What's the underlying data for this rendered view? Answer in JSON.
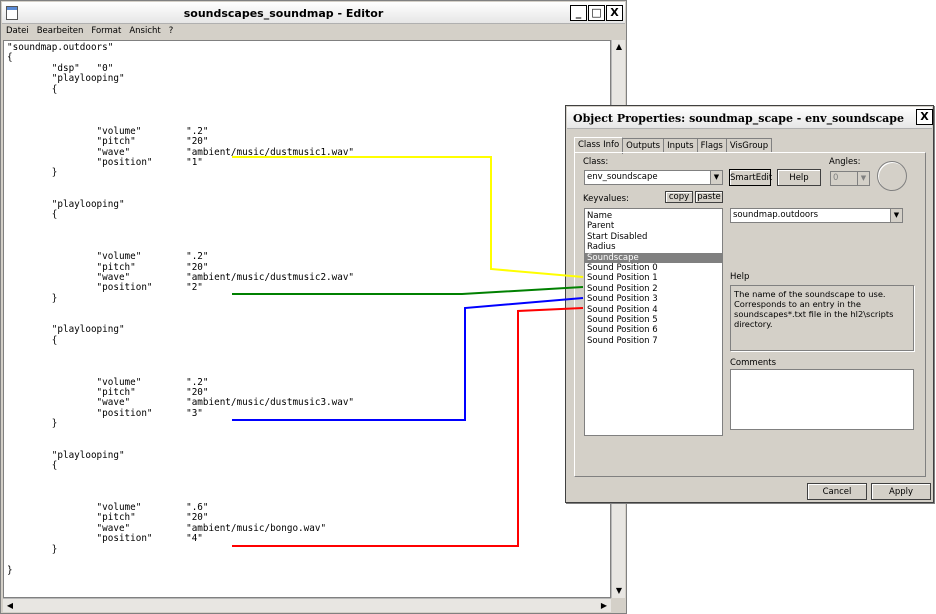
{
  "editor": {
    "title": "soundscapes_soundmap - Editor",
    "menu": [
      "Datei",
      "Bearbeiten",
      "Format",
      "Ansicht",
      "?"
    ],
    "window_buttons": {
      "minimize": "_",
      "maximize": "□",
      "close": "X"
    },
    "content": "\"soundmap.outdoors\"\n{\n        \"dsp\"   \"0\"\n        \"playlooping\"\n        {\n\n\n\n                \"volume\"        \".2\"\n                \"pitch\"         \"20\"\n                \"wave\"          \"ambient/music/dustmusic1.wav\"\n                \"position\"      \"1\"\n        }\n\n\n        \"playlooping\"\n        {\n\n\n\n                \"volume\"        \".2\"\n                \"pitch\"         \"20\"\n                \"wave\"          \"ambient/music/dustmusic2.wav\"\n                \"position\"      \"2\"\n        }\n\n\n        \"playlooping\"\n        {\n\n\n\n                \"volume\"        \".2\"\n                \"pitch\"         \"20\"\n                \"wave\"          \"ambient/music/dustmusic3.wav\"\n                \"position\"      \"3\"\n        }\n\n\n        \"playlooping\"\n        {\n\n\n\n                \"volume\"        \".6\"\n                \"pitch\"         \"20\"\n                \"wave\"          \"ambient/music/bongo.wav\"\n                \"position\"      \"4\"\n        }\n\n}"
  },
  "props": {
    "title": "Object Properties: soundmap_scape - env_soundscape",
    "close": "X",
    "tabs": [
      "Class Info",
      "Outputs",
      "Inputs",
      "Flags",
      "VisGroup"
    ],
    "class_label": "Class:",
    "class_value": "env_soundscape",
    "smartedit": "SmartEdit",
    "help_button": "Help",
    "angles_label": "Angles:",
    "angles_value": "0",
    "keyvalues_label": "Keyvalues:",
    "copy": "copy",
    "paste": "paste",
    "keyvalues": [
      "Name",
      "Parent",
      "Start Disabled",
      "Radius",
      "Soundscape",
      "Sound Position 0",
      "Sound Position 1",
      "Sound Position 2",
      "Sound Position 3",
      "Sound Position 4",
      "Sound Position 5",
      "Sound Position 6",
      "Sound Position 7"
    ],
    "selected_keyvalue": "Soundscape",
    "value": "soundmap.outdoors",
    "help_label": "Help",
    "help_text": "The name of the soundscape to use. Corresponds to an entry in the soundscapes*.txt file in the hl2\\scripts directory.",
    "comments_label": "Comments",
    "cancel": "Cancel",
    "apply": "Apply"
  },
  "connector_colors": {
    "position1": "#ffff00",
    "position2": "#008000",
    "position3": "#0000ff",
    "position4": "#ff0000"
  }
}
